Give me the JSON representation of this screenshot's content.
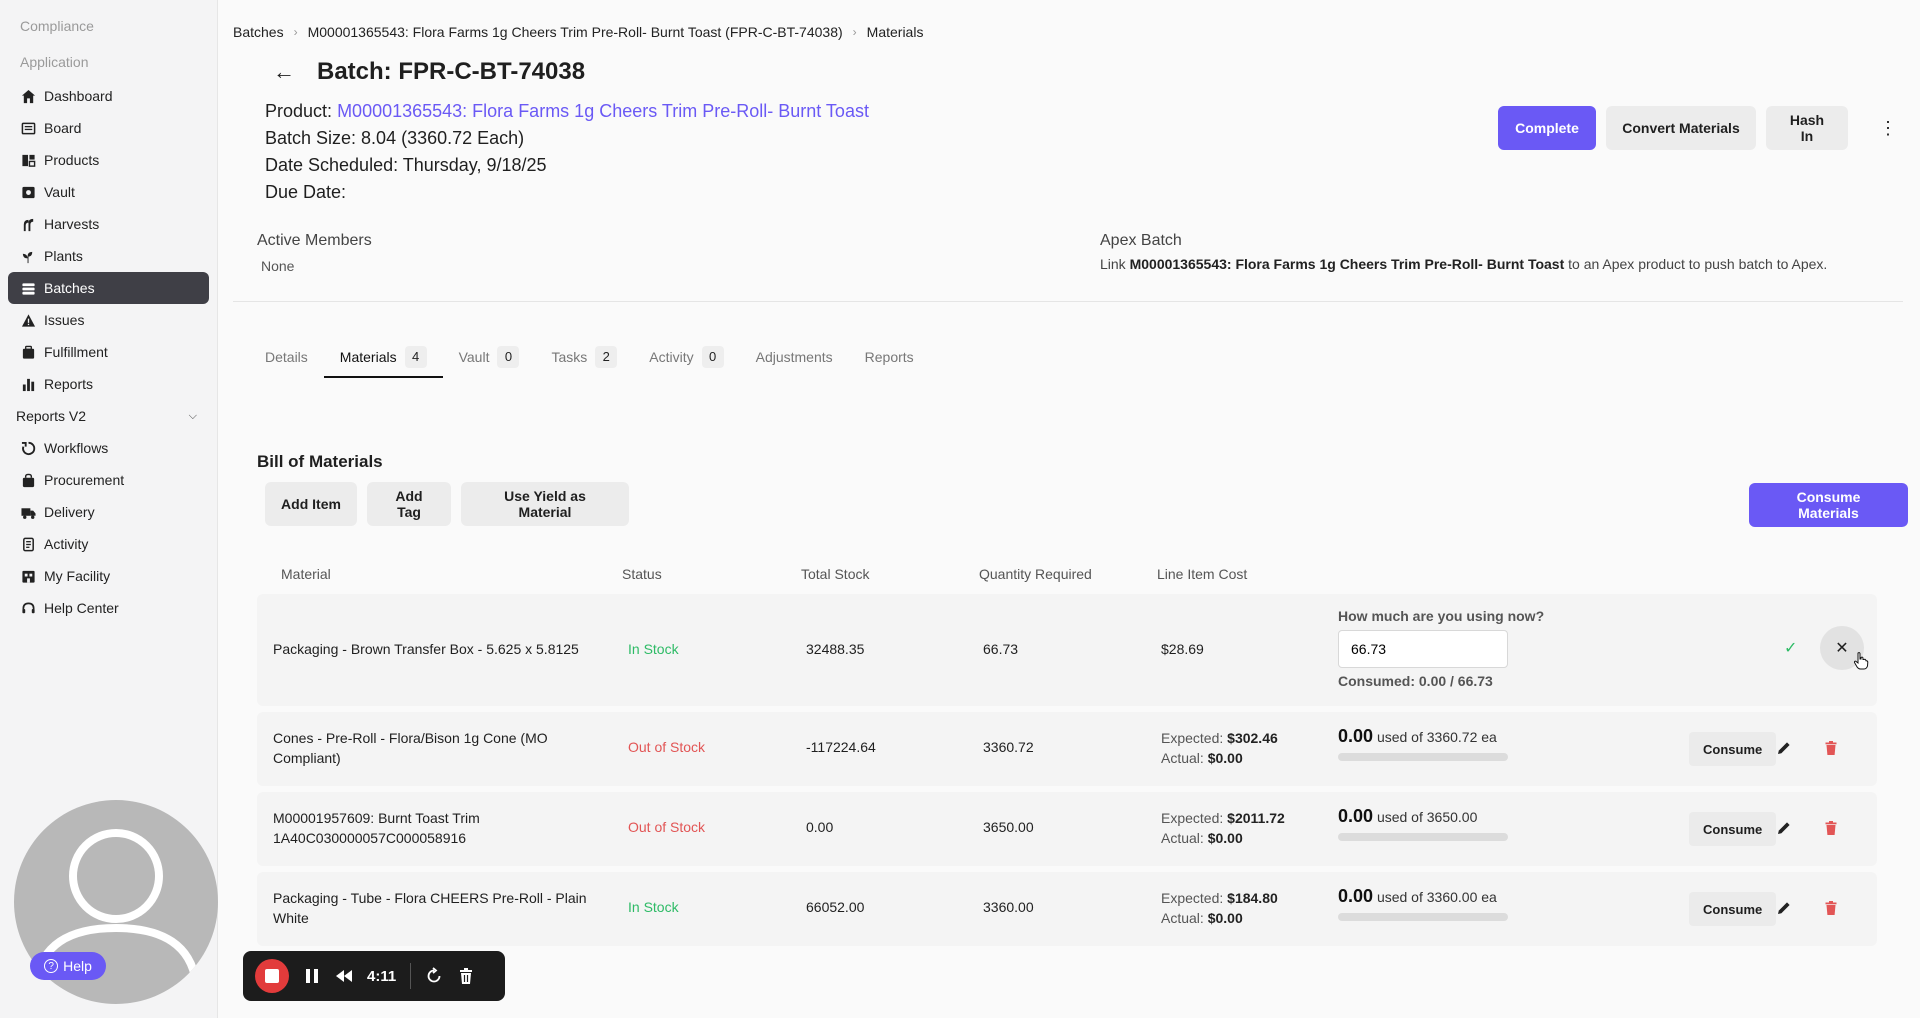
{
  "sidebar": {
    "sections": [
      "Compliance",
      "Application"
    ],
    "items": [
      {
        "label": "Dashboard",
        "icon": "home-icon",
        "active": false
      },
      {
        "label": "Board",
        "icon": "board-icon",
        "active": false
      },
      {
        "label": "Products",
        "icon": "products-icon",
        "active": false
      },
      {
        "label": "Vault",
        "icon": "vault-icon",
        "active": false
      },
      {
        "label": "Harvests",
        "icon": "harvest-icon",
        "active": false
      },
      {
        "label": "Plants",
        "icon": "plant-icon",
        "active": false
      },
      {
        "label": "Batches",
        "icon": "batches-icon",
        "active": true
      },
      {
        "label": "Issues",
        "icon": "warning-icon",
        "active": false
      },
      {
        "label": "Fulfillment",
        "icon": "fulfillment-icon",
        "active": false
      },
      {
        "label": "Reports",
        "icon": "bar-chart-icon",
        "active": false
      }
    ],
    "group": {
      "label": "Reports V2"
    },
    "items2": [
      {
        "label": "Workflows",
        "icon": "workflow-icon"
      },
      {
        "label": "Procurement",
        "icon": "bag-icon"
      },
      {
        "label": "Delivery",
        "icon": "truck-icon"
      },
      {
        "label": "Activity",
        "icon": "activity-icon"
      },
      {
        "label": "My Facility",
        "icon": "facility-icon"
      },
      {
        "label": "Help Center",
        "icon": "headset-icon"
      }
    ],
    "help_label": "Help"
  },
  "recorder": {
    "time": "4:11"
  },
  "breadcrumb": [
    "Batches",
    "M00001365543: Flora Farms 1g Cheers Trim Pre-Roll- Burnt Toast (FPR-C-BT-74038)",
    "Materials"
  ],
  "header": {
    "title": "Batch: FPR-C-BT-74038",
    "product_label": "Product:",
    "product_link": "M00001365543: Flora Farms 1g Cheers Trim Pre-Roll- Burnt Toast",
    "batch_size": "Batch Size: 8.04 (3360.72 Each)",
    "date_scheduled": "Date Scheduled: Thursday, 9/18/25",
    "due_date": "Due Date:"
  },
  "actions": {
    "complete": "Complete",
    "convert": "Convert Materials",
    "hash_in": "Hash In"
  },
  "members": {
    "label": "Active Members",
    "value": "None"
  },
  "apex": {
    "label": "Apex Batch",
    "pre": "Link",
    "product": "M00001365543: Flora Farms 1g Cheers Trim Pre-Roll- Burnt Toast",
    "post": "to an Apex product to push batch to Apex."
  },
  "tabs": [
    {
      "label": "Details",
      "count": null
    },
    {
      "label": "Materials",
      "count": "4",
      "active": true
    },
    {
      "label": "Vault",
      "count": "0"
    },
    {
      "label": "Tasks",
      "count": "2"
    },
    {
      "label": "Activity",
      "count": "0"
    },
    {
      "label": "Adjustments",
      "count": null
    },
    {
      "label": "Reports",
      "count": null
    }
  ],
  "bom": {
    "title": "Bill of Materials",
    "add_item": "Add Item",
    "add_tag": "Add Tag",
    "use_yield": "Use Yield as Material",
    "consume_all": "Consume Materials",
    "columns": [
      "Material",
      "Status",
      "Total Stock",
      "Quantity Required",
      "Line Item Cost"
    ],
    "editing_row": {
      "material": "Packaging - Brown Transfer Box - 5.625 x 5.8125",
      "status": "In Stock",
      "total_stock": "32488.35",
      "qty_required": "66.73",
      "cost": "$28.69",
      "prompt": "How much are you using now?",
      "input_value": "66.73",
      "consumed": "Consumed: 0.00 / 66.73"
    },
    "rows": [
      {
        "material_1": "Cones - Pre-Roll - Flora/Bison 1g Cone (MO",
        "material_2": "Compliant)",
        "status": "Out of Stock",
        "status_type": "out",
        "total_stock": "-117224.64",
        "qty_required": "3360.72",
        "expected_label": "Expected:",
        "expected": "$302.46",
        "actual_label": "Actual:",
        "actual": "$0.00",
        "used_amount": "0.00",
        "used_of": "used of 3360.72 ea",
        "progress": 0,
        "consume": "Consume"
      },
      {
        "material_1": "M00001957609: Burnt Toast Trim",
        "material_2": "1A40C030000057C000058916",
        "status": "Out of Stock",
        "status_type": "out",
        "total_stock": "0.00",
        "qty_required": "3650.00",
        "expected_label": "Expected:",
        "expected": "$2011.72",
        "actual_label": "Actual:",
        "actual": "$0.00",
        "used_amount": "0.00",
        "used_of": "used of 3650.00",
        "progress": 0,
        "consume": "Consume"
      },
      {
        "material_1": "Packaging - Tube - Flora CHEERS Pre-Roll - Plain",
        "material_2": "White",
        "status": "In Stock",
        "status_type": "in",
        "total_stock": "66052.00",
        "qty_required": "3360.00",
        "expected_label": "Expected:",
        "expected": "$184.80",
        "actual_label": "Actual:",
        "actual": "$0.00",
        "used_amount": "0.00",
        "used_of": "used of 3360.00 ea",
        "progress": 0,
        "consume": "Consume"
      }
    ]
  },
  "colors": {
    "accent": "#6a59f5",
    "in_stock": "#2ebb66",
    "out_of_stock": "#e25555",
    "sidebar_active": "#3f3f46"
  }
}
